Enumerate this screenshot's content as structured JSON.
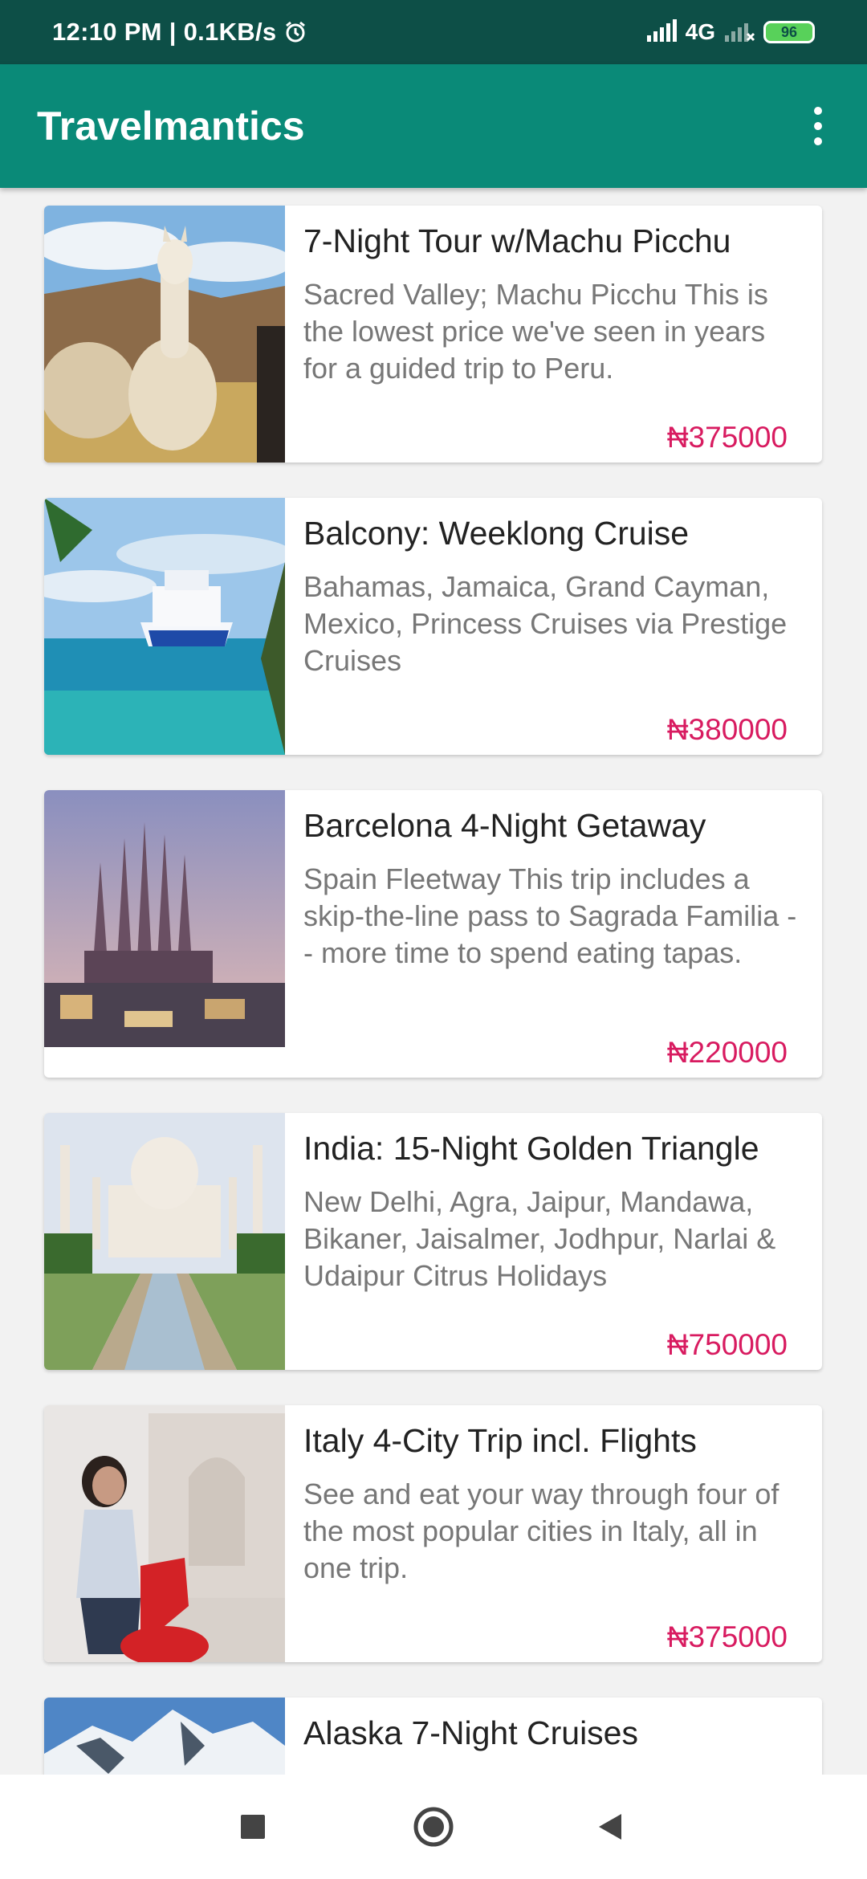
{
  "status_bar": {
    "time_speed": "12:10 PM | 0.1KB/s",
    "network": "4G",
    "battery": "96"
  },
  "app_bar": {
    "title": "Travelmantics"
  },
  "deals": [
    {
      "title": "7-Night Tour w/Machu Picchu",
      "description": "Sacred Valley; Machu Picchu This is the lowest price we've seen in years for a guided trip to Peru.",
      "price": "₦375000",
      "image_icon": "llama-photo"
    },
    {
      "title": " Balcony: Weeklong Cruise",
      "description": "Bahamas, Jamaica, Grand Cayman, Mexico, Princess Cruises via Prestige Cruises",
      "price": "₦380000",
      "image_icon": "cruise-ship-photo"
    },
    {
      "title": "Barcelona 4-Night Getaway",
      "description": "Spain Fleetway This trip includes a skip-the-line pass to Sagrada Familia -- more time to spend eating tapas.",
      "price": "₦220000",
      "image_icon": "sagrada-familia-photo"
    },
    {
      "title": "India: 15-Night Golden Triangle",
      "description": "New Delhi, Agra, Jaipur, Mandawa, Bikaner, Jaisalmer, Jodhpur, Narlai & Udaipur Citrus Holidays",
      "price": "₦750000",
      "image_icon": "taj-mahal-photo"
    },
    {
      "title": "Italy 4-City Trip incl. Flights",
      "description": "See and eat your way through four of the most popular cities in Italy, all in one trip.",
      "price": "₦375000",
      "image_icon": "italy-scooter-photo"
    },
    {
      "title": "Alaska 7-Night Cruises",
      "description": "",
      "price": "",
      "image_icon": "alaska-mountain-photo"
    }
  ],
  "colors": {
    "status_bar": "#0d4f47",
    "app_bar": "#0a8a78",
    "price": "#d81b60",
    "background": "#f2f2f2"
  }
}
